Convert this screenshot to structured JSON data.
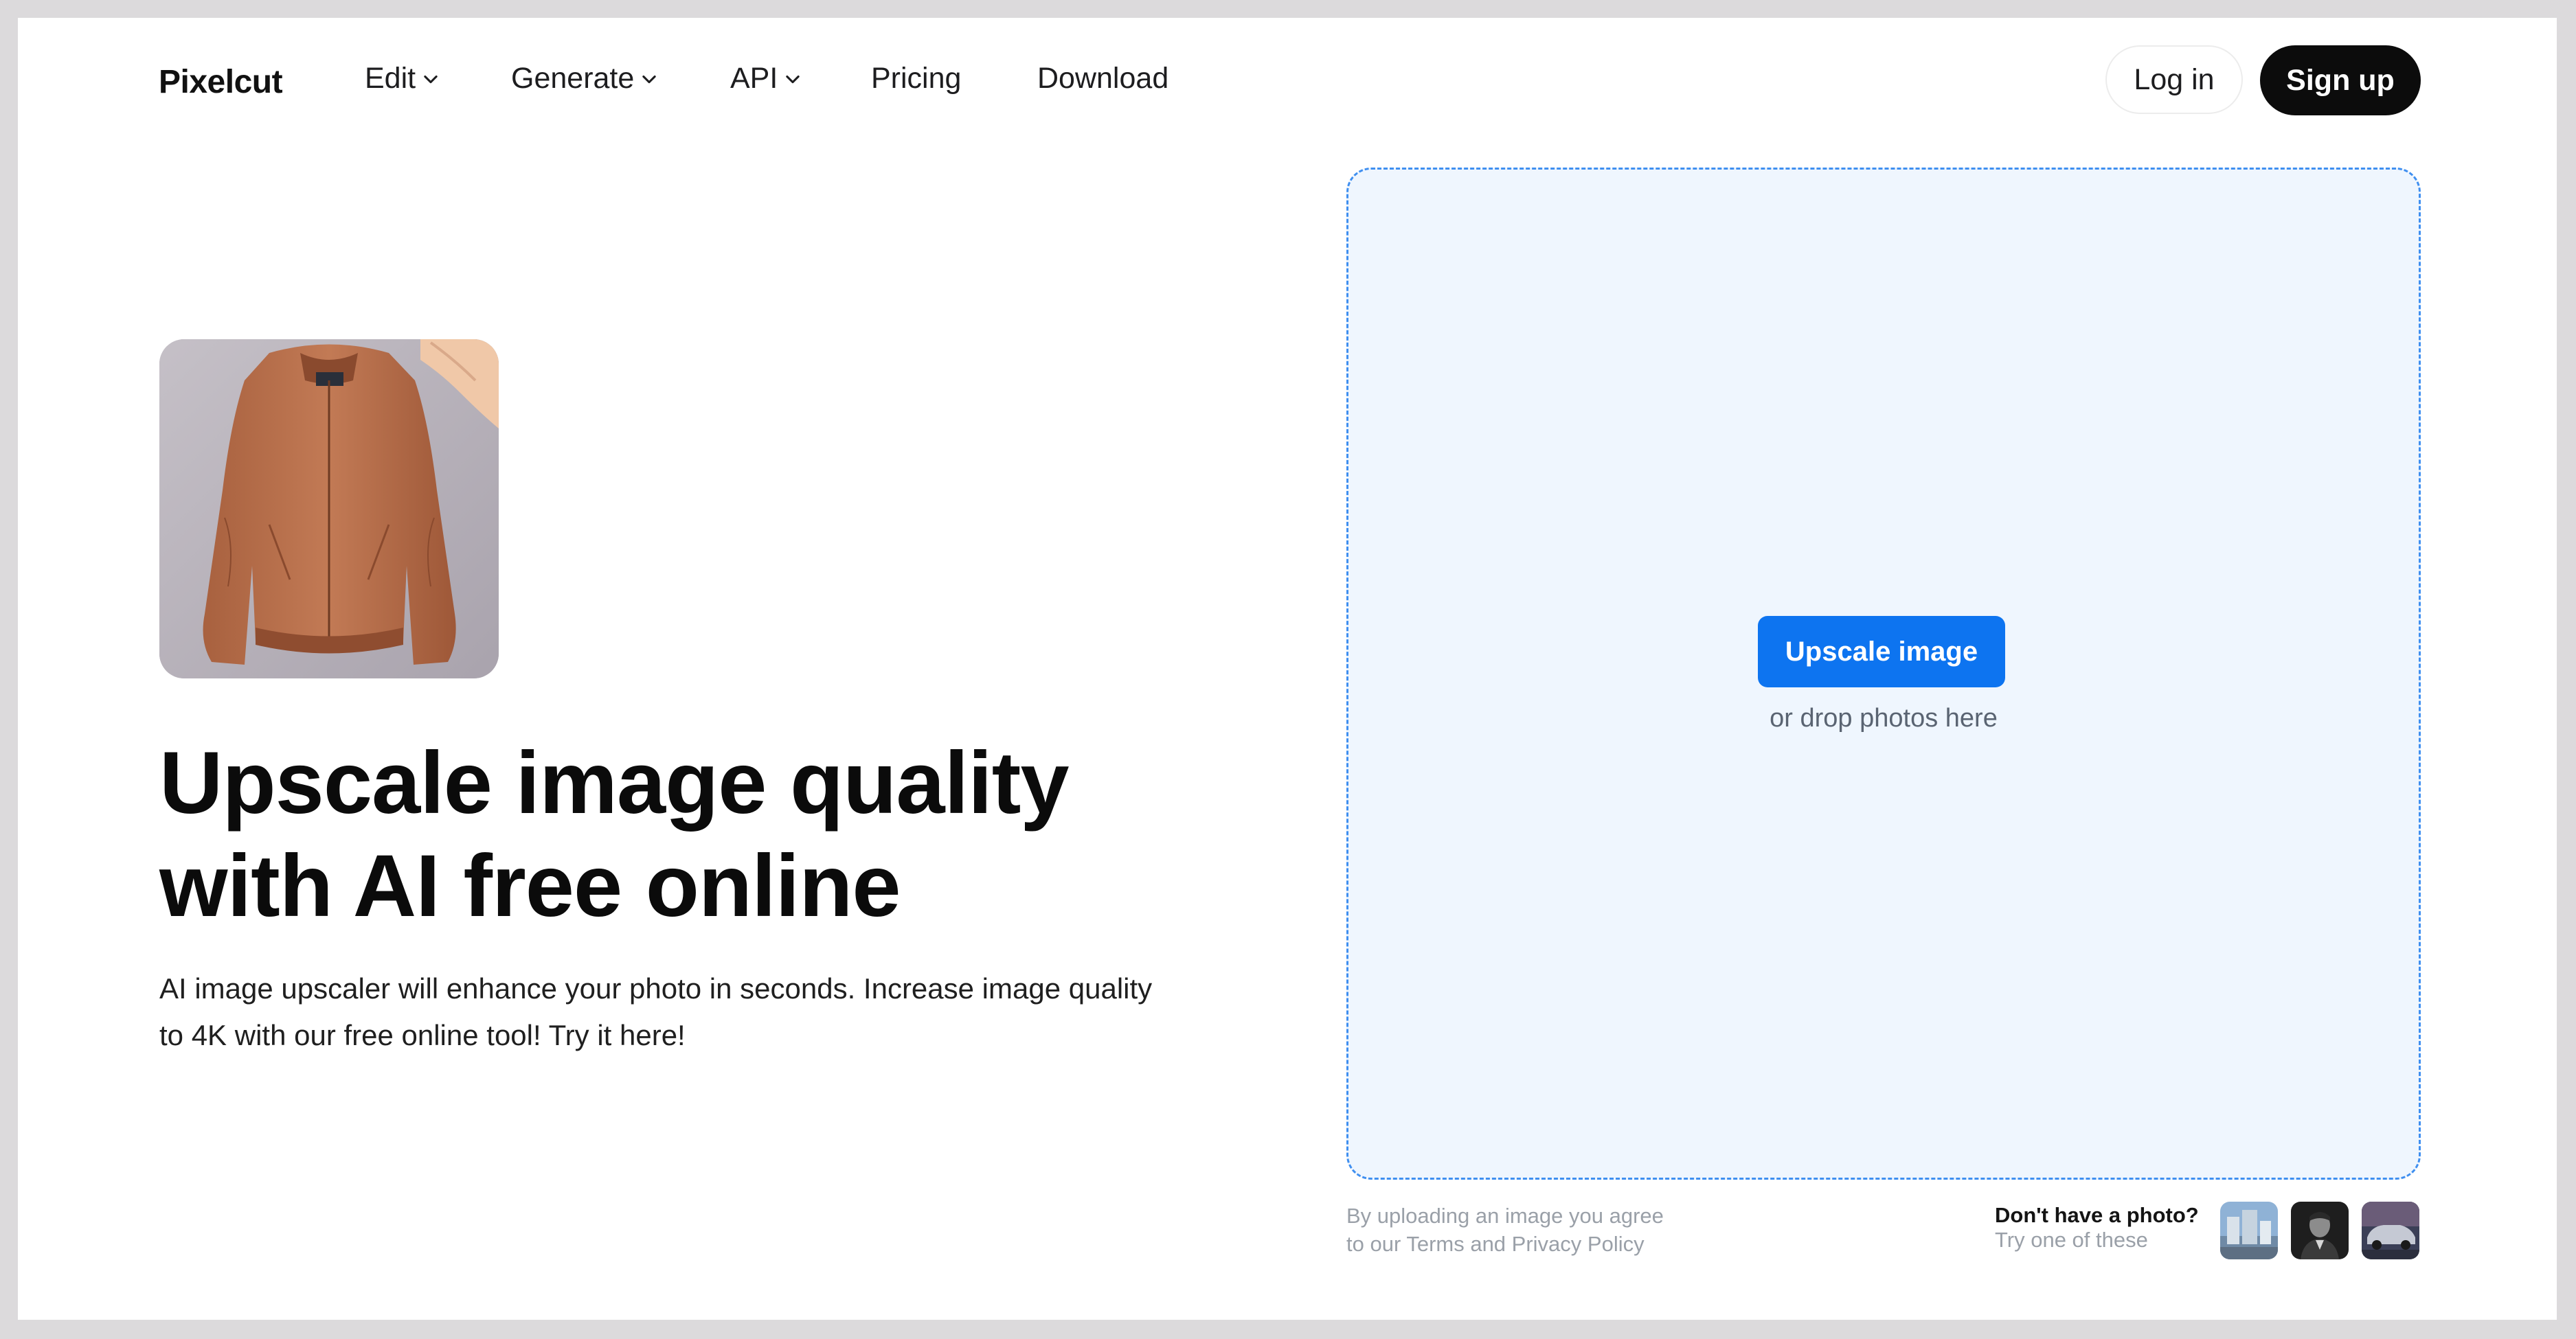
{
  "nav": {
    "logo": "Pixelcut",
    "items": [
      {
        "label": "Edit",
        "dropdown": true
      },
      {
        "label": "Generate",
        "dropdown": true
      },
      {
        "label": "API",
        "dropdown": true
      },
      {
        "label": "Pricing",
        "dropdown": false
      },
      {
        "label": "Download",
        "dropdown": false
      }
    ],
    "login_label": "Log in",
    "signup_label": "Sign up"
  },
  "hero": {
    "title_line1": "Upscale image quality",
    "title_line2": "with AI free online",
    "subtitle": "AI image upscaler will enhance your photo in seconds. Increase image quality to 4K with our free online tool! Try it here!"
  },
  "dropzone": {
    "button_label": "Upscale image",
    "hint": "or drop photos here"
  },
  "terms": {
    "line1": "By uploading an image you agree",
    "line2": "to our Terms and Privacy Policy"
  },
  "samples": {
    "title": "Don't have a photo?",
    "subtitle": "Try one of these"
  },
  "colors": {
    "accent": "#0d74f0",
    "dropzone_bg": "#eff6fe",
    "dropzone_border": "#3f8ff0",
    "signup_bg": "#0c0c0c"
  }
}
